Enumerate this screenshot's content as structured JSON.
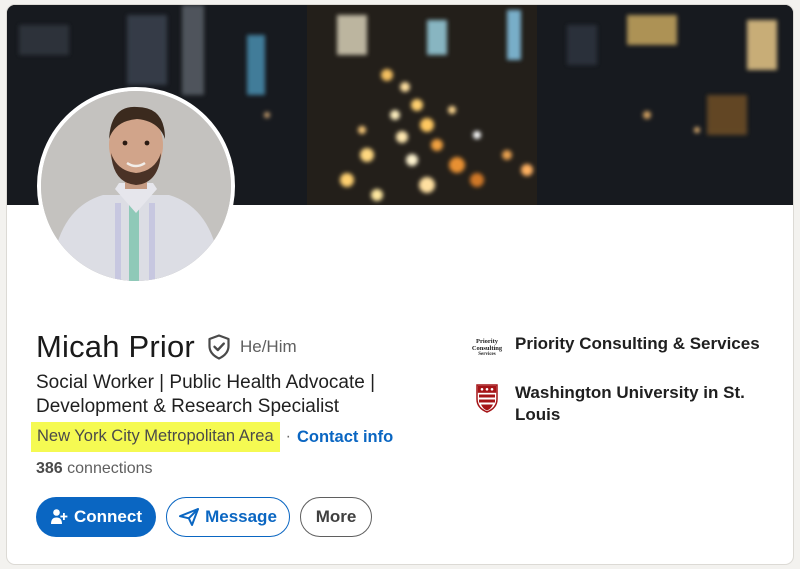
{
  "profile": {
    "name": "Micah Prior",
    "pronouns": "He/Him",
    "headline_lines": [
      "Social Worker | Public Health Advocate |",
      "Development & Research Specialist"
    ],
    "location": "New York City Metropolitan Area",
    "separator": "·",
    "contact_label": "Contact info",
    "connections_count": "386",
    "connections_label": "connections"
  },
  "actions": {
    "connect_label": "Connect",
    "message_label": "Message",
    "more_label": "More"
  },
  "experience": [
    {
      "name": "Priority Consulting & Services",
      "logo_text": [
        "Priority",
        "Consulting",
        "Services"
      ]
    },
    {
      "name": "Washington University in St. Louis"
    }
  ],
  "colors": {
    "accent": "#0a66c2",
    "location_highlight": "#f5fa52",
    "university_red": "#a51417"
  },
  "icons": [
    "verified-shield-icon",
    "add-person-icon",
    "send-icon",
    "university-shield-icon"
  ]
}
